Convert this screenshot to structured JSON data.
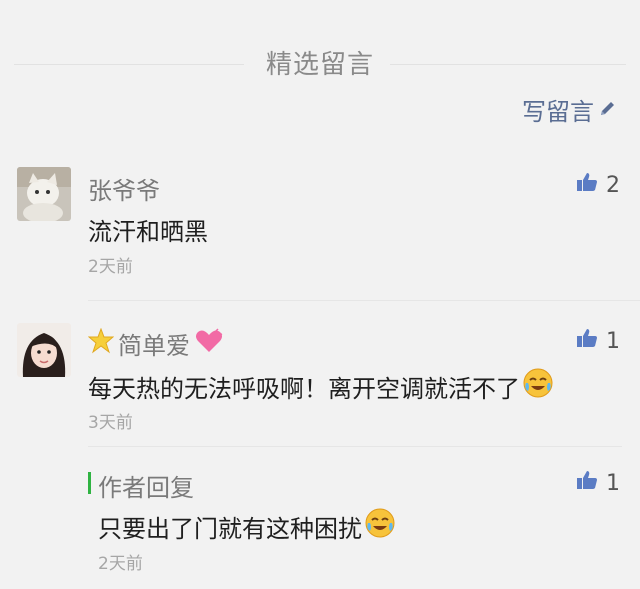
{
  "section": {
    "title": "精选留言"
  },
  "write_button": {
    "label": "写留言"
  },
  "comments": [
    {
      "name": "张爷爷",
      "content": "流汗和晒黑",
      "time": "2天前",
      "likes": "2"
    },
    {
      "name": "简单爱",
      "content": "每天热的无法呼吸啊！离开空调就活不了",
      "time": "3天前",
      "likes": "1",
      "reply": {
        "label": "作者回复",
        "content": "只要出了门就有这种困扰",
        "time": "2天前",
        "likes": "1"
      }
    }
  ],
  "colors": {
    "link": "#5a6d93",
    "reply_accent": "#2fb342",
    "like_icon": "#5b7cc4"
  },
  "icons": [
    "pencil-icon",
    "thumbs-up-icon",
    "star-icon",
    "heart-icon",
    "crying-laughing-emoji"
  ]
}
